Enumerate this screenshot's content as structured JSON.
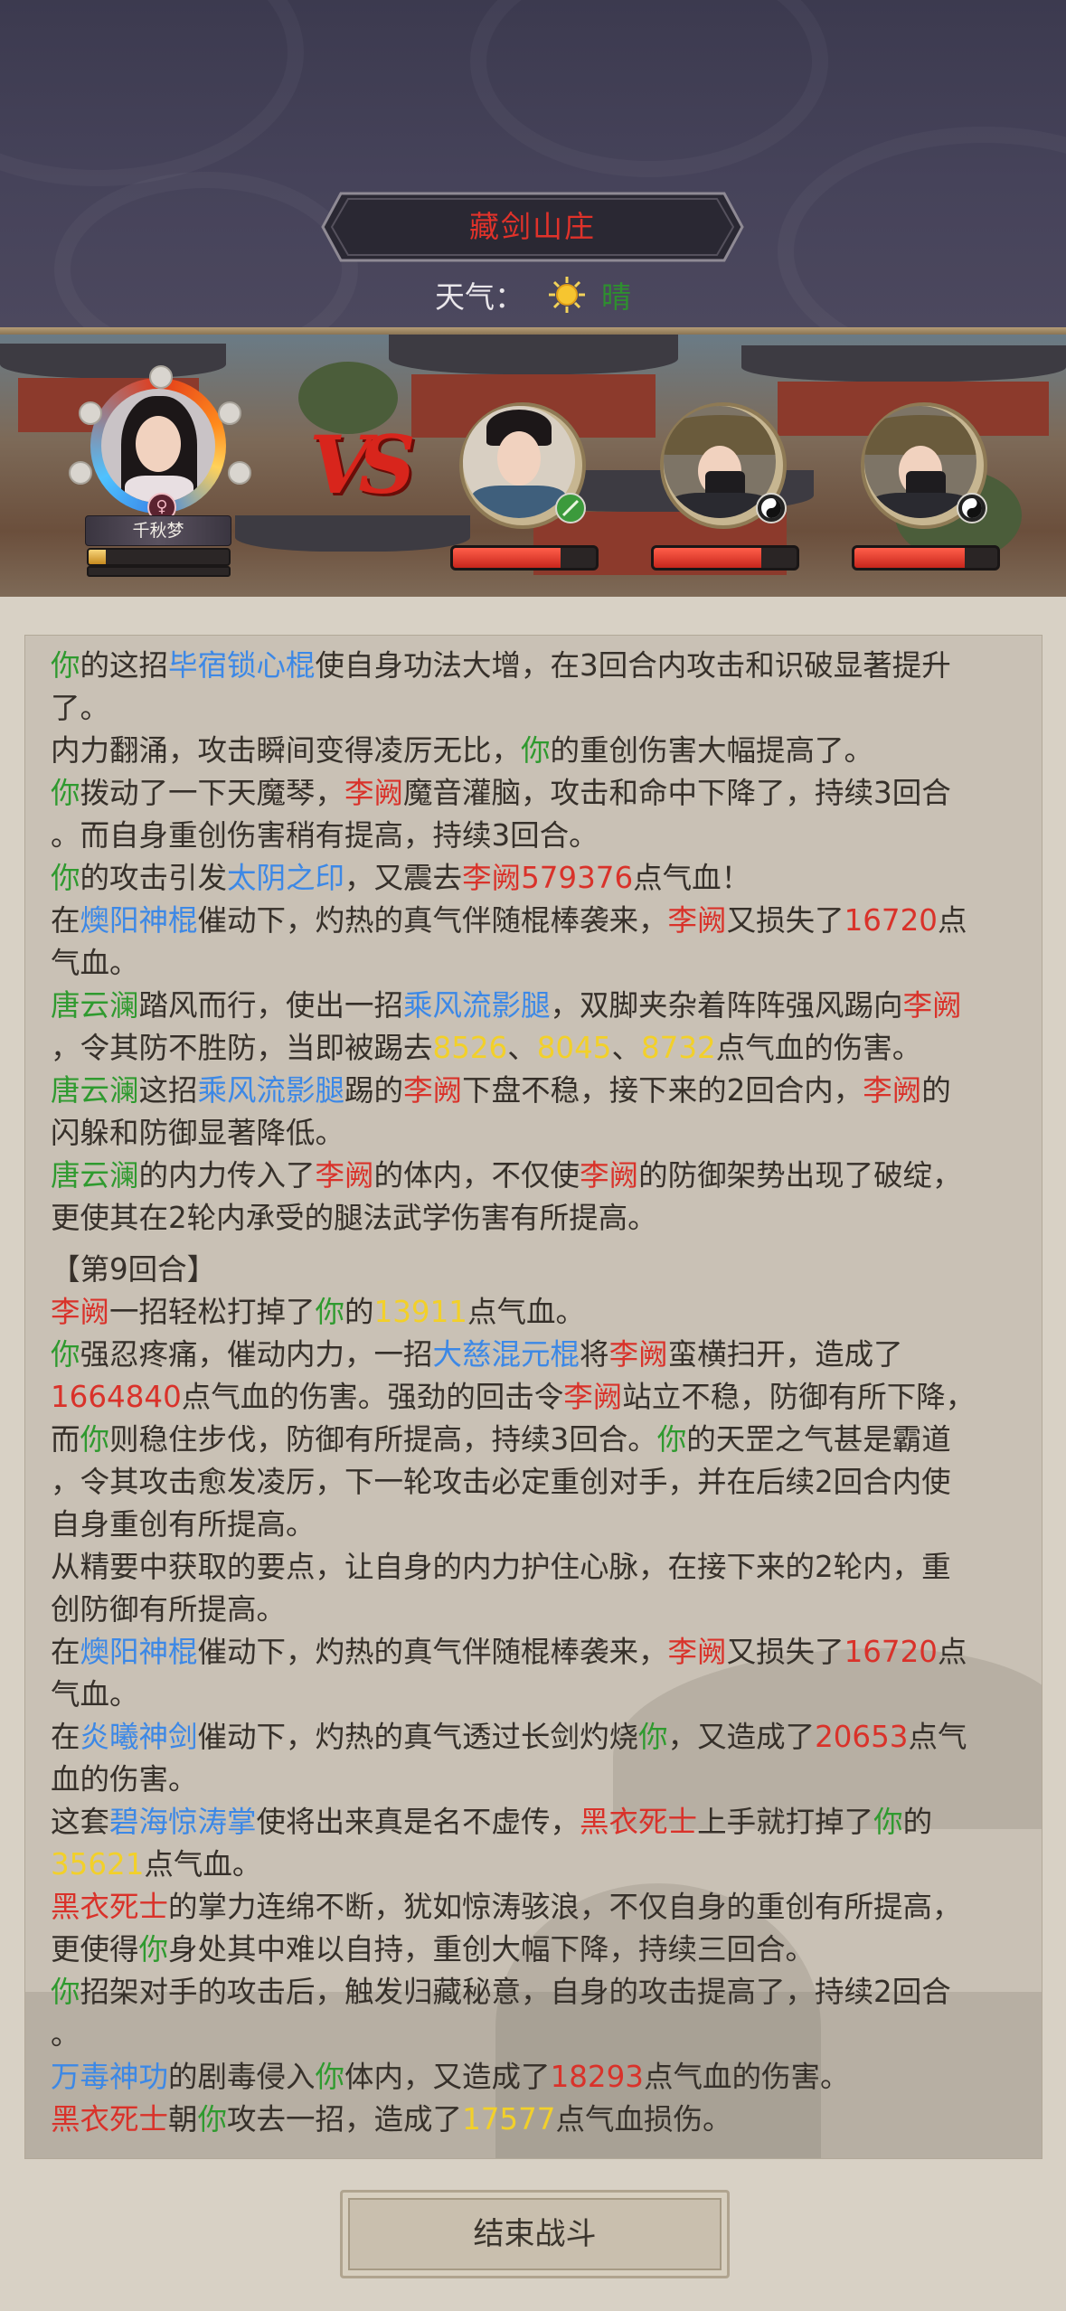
{
  "header": {
    "location": "藏剑山庄",
    "weather_label": "天气：",
    "weather_value": "晴",
    "weather_icon": "sun-icon"
  },
  "battle": {
    "player": {
      "name": "千秋梦",
      "gender_icon": "female-icon",
      "bar_fill": 0.12
    },
    "vs_icon": "vs-emblem",
    "enemies": [
      {
        "portrait": "swordsman-portrait",
        "badge_icon": "sword-skill-icon",
        "hp_fraction": 0.75
      },
      {
        "portrait": "masked-assassin-portrait",
        "badge_icon": "yin-yang-icon",
        "hp_fraction": 0.75
      },
      {
        "portrait": "masked-assassin-portrait",
        "badge_icon": "yin-yang-icon",
        "hp_fraction": 0.77
      }
    ]
  },
  "colors": {
    "ally": "#2f9a2f",
    "skill": "#3c88e6",
    "enemy": "#d9322a",
    "heal_number": "#f2d02a"
  },
  "log": [
    [
      [
        "g",
        "你"
      ],
      [
        "n",
        "的这招"
      ],
      [
        "b",
        "毕宿锁心棍"
      ],
      [
        "n",
        "使自身功法大增，在3回合内攻击和识破显著提升"
      ]
    ],
    [
      [
        "n",
        "了。"
      ]
    ],
    [
      [
        "n",
        "内力翻涌，攻击瞬间变得凌厉无比，"
      ],
      [
        "g",
        "你"
      ],
      [
        "n",
        "的重创伤害大幅提高了。"
      ]
    ],
    [
      [
        "g",
        "你"
      ],
      [
        "n",
        "拨动了一下天魔琴，"
      ],
      [
        "r",
        "李阙"
      ],
      [
        "n",
        "魔音灌脑，攻击和命中下降了，持续3回合"
      ]
    ],
    [
      [
        "n",
        "。而自身重创伤害稍有提高，持续3回合。"
      ]
    ],
    [
      [
        "g",
        "你"
      ],
      [
        "n",
        "的攻击引发"
      ],
      [
        "b",
        "太阴之印"
      ],
      [
        "n",
        "，又震去"
      ],
      [
        "r",
        "李阙579376"
      ],
      [
        "n",
        "点气血！"
      ]
    ],
    [
      [
        "n",
        "在"
      ],
      [
        "b",
        "燠阳神棍"
      ],
      [
        "n",
        "催动下，灼热的真气伴随棍棒袭来，"
      ],
      [
        "r",
        "李阙"
      ],
      [
        "n",
        "又损失了"
      ],
      [
        "r",
        "16720"
      ],
      [
        "n",
        "点"
      ]
    ],
    [
      [
        "n",
        "气血。"
      ]
    ],
    [
      [
        "g",
        "唐云澜"
      ],
      [
        "n",
        "踏风而行，使出一招"
      ],
      [
        "b",
        "乘风流影腿"
      ],
      [
        "n",
        "，双脚夹杂着阵阵强风踢向"
      ],
      [
        "r",
        "李阙"
      ]
    ],
    [
      [
        "n",
        "，令其防不胜防，当即被踢去"
      ],
      [
        "y",
        "8526"
      ],
      [
        "n",
        "、"
      ],
      [
        "y",
        "8045"
      ],
      [
        "n",
        "、"
      ],
      [
        "y",
        "8732"
      ],
      [
        "n",
        "点气血的伤害。"
      ]
    ],
    [
      [
        "g",
        "唐云澜"
      ],
      [
        "n",
        "这招"
      ],
      [
        "b",
        "乘风流影腿"
      ],
      [
        "n",
        "踢的"
      ],
      [
        "r",
        "李阙"
      ],
      [
        "n",
        "下盘不稳，接下来的2回合内，"
      ],
      [
        "r",
        "李阙"
      ],
      [
        "n",
        "的"
      ]
    ],
    [
      [
        "n",
        "闪躲和防御显著降低。"
      ]
    ],
    [
      [
        "g",
        "唐云澜"
      ],
      [
        "n",
        "的内力传入了"
      ],
      [
        "r",
        "李阙"
      ],
      [
        "n",
        "的体内，不仅使"
      ],
      [
        "r",
        "李阙"
      ],
      [
        "n",
        "的防御架势出现了破绽，"
      ]
    ],
    [
      [
        "n",
        "更使其在2轮内承受的腿法武学伤害有所提高。"
      ]
    ],
    [
      [
        "n",
        "【第9回合】"
      ]
    ],
    [
      [
        "r",
        "李阙"
      ],
      [
        "n",
        "一招轻松打掉了"
      ],
      [
        "g",
        "你"
      ],
      [
        "n",
        "的"
      ],
      [
        "y",
        "13911"
      ],
      [
        "n",
        "点气血。"
      ]
    ],
    [
      [
        "g",
        "你"
      ],
      [
        "n",
        "强忍疼痛，催动内力，一招"
      ],
      [
        "b",
        "大慈混元棍"
      ],
      [
        "n",
        "将"
      ],
      [
        "r",
        "李阙"
      ],
      [
        "n",
        "蛮横扫开，造成了"
      ]
    ],
    [
      [
        "r",
        "1664840"
      ],
      [
        "n",
        "点气血的伤害。强劲的回击令"
      ],
      [
        "r",
        "李阙"
      ],
      [
        "n",
        "站立不稳，防御有所下降，"
      ]
    ],
    [
      [
        "n",
        "而"
      ],
      [
        "g",
        "你"
      ],
      [
        "n",
        "则稳住步伐，防御有所提高，持续3回合。"
      ],
      [
        "g",
        "你"
      ],
      [
        "n",
        "的天罡之气甚是霸道"
      ]
    ],
    [
      [
        "n",
        "，令其攻击愈发凌厉，下一轮攻击必定重创对手，并在后续2回合内使"
      ]
    ],
    [
      [
        "n",
        "自身重创有所提高。"
      ]
    ],
    [
      [
        "n",
        "从精要中获取的要点，让自身的内力护住心脉，在接下来的2轮内，重"
      ]
    ],
    [
      [
        "n",
        "创防御有所提高。"
      ]
    ],
    [
      [
        "n",
        "在"
      ],
      [
        "b",
        "燠阳神棍"
      ],
      [
        "n",
        "催动下，灼热的真气伴随棍棒袭来，"
      ],
      [
        "r",
        "李阙"
      ],
      [
        "n",
        "又损失了"
      ],
      [
        "r",
        "16720"
      ],
      [
        "n",
        "点"
      ]
    ],
    [
      [
        "n",
        "气血。"
      ]
    ],
    [
      [
        "n",
        "在"
      ],
      [
        "b",
        "炎曦神剑"
      ],
      [
        "n",
        "催动下，灼热的真气透过长剑灼烧"
      ],
      [
        "g",
        "你"
      ],
      [
        "n",
        "，又造成了"
      ],
      [
        "r",
        "20653"
      ],
      [
        "n",
        "点气"
      ]
    ],
    [
      [
        "n",
        "血的伤害。"
      ]
    ],
    [
      [
        "n",
        "这套"
      ],
      [
        "b",
        "碧海惊涛掌"
      ],
      [
        "n",
        "使将出来真是名不虚传，"
      ],
      [
        "r",
        "黑衣死士"
      ],
      [
        "n",
        "上手就打掉了"
      ],
      [
        "g",
        "你"
      ],
      [
        "n",
        "的"
      ]
    ],
    [
      [
        "y",
        "35621"
      ],
      [
        "n",
        "点气血。"
      ]
    ],
    [
      [
        "r",
        "黑衣死士"
      ],
      [
        "n",
        "的掌力连绵不断，犹如惊涛骇浪，不仅自身的重创有所提高，"
      ]
    ],
    [
      [
        "n",
        "更使得"
      ],
      [
        "g",
        "你"
      ],
      [
        "n",
        "身处其中难以自持，重创大幅下降，持续三回合。"
      ]
    ],
    [
      [
        "g",
        "你"
      ],
      [
        "n",
        "招架对手的攻击后，触发归藏秘意，自身的攻击提高了，持续2回合"
      ]
    ],
    [
      [
        "n",
        "。"
      ]
    ],
    [
      [
        "b",
        "万毒神功"
      ],
      [
        "n",
        "的剧毒侵入"
      ],
      [
        "g",
        "你"
      ],
      [
        "n",
        "体内，又造成了"
      ],
      [
        "r",
        "18293"
      ],
      [
        "n",
        "点气血的伤害。"
      ]
    ],
    [
      [
        "r",
        "黑衣死士"
      ],
      [
        "n",
        "朝"
      ],
      [
        "g",
        "你"
      ],
      [
        "n",
        "攻去一招，造成了"
      ],
      [
        "y",
        "17577"
      ],
      [
        "n",
        "点气血损伤。"
      ]
    ]
  ],
  "end_button": "结束战斗"
}
